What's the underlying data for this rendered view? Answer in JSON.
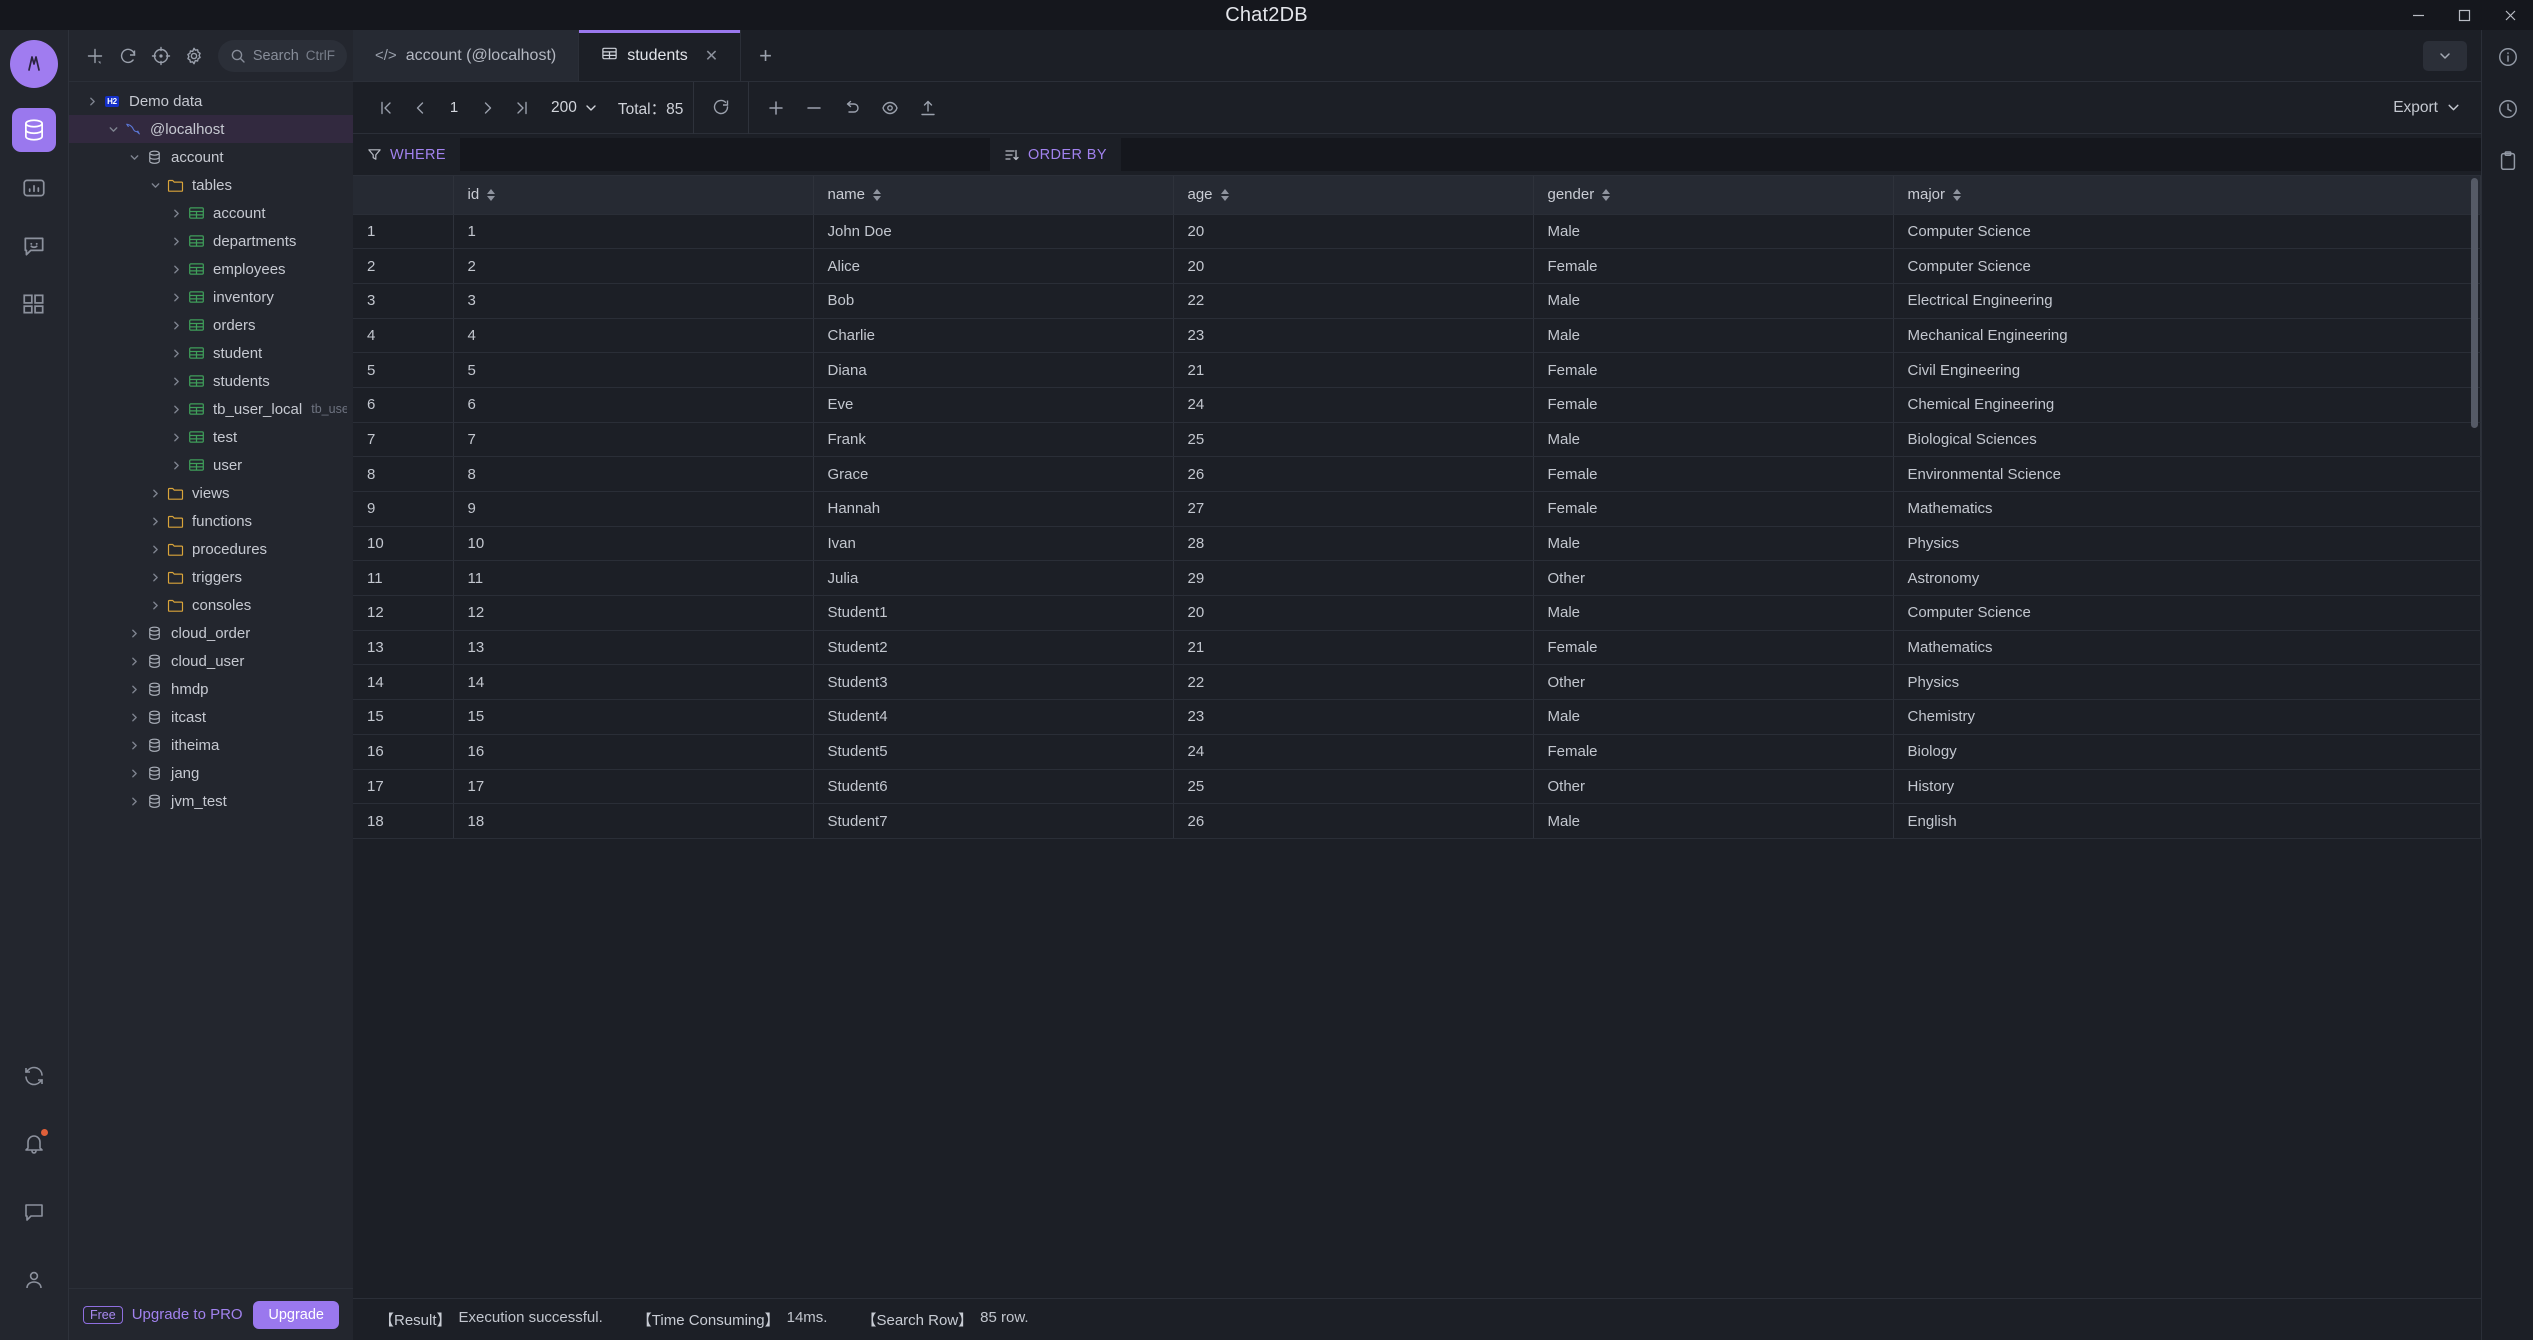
{
  "window": {
    "title": "Chat2DB",
    "controls": [
      "minimize",
      "maximize",
      "close"
    ]
  },
  "rail": {
    "logo": "chat2db-logo",
    "items": [
      {
        "name": "database",
        "icon": "database-icon",
        "active": true
      },
      {
        "name": "dashboard",
        "icon": "chart-bar-icon",
        "active": false
      },
      {
        "name": "chat",
        "icon": "chat-smile-icon",
        "active": false
      },
      {
        "name": "extensions",
        "icon": "grid-blocks-icon",
        "active": false
      }
    ],
    "bottom": [
      {
        "name": "sync",
        "icon": "sync-icon"
      },
      {
        "name": "notifications",
        "icon": "bell-icon"
      },
      {
        "name": "feedback",
        "icon": "message-icon"
      },
      {
        "name": "account",
        "icon": "user-icon"
      }
    ]
  },
  "sidebar": {
    "toolbar": {
      "add": "add-icon",
      "refresh": "refresh-icon",
      "locate": "target-icon",
      "settings": "gear-icon"
    },
    "search": {
      "placeholder": "Search",
      "shortcut": "CtrlF"
    },
    "tree": [
      {
        "label": "Demo data",
        "icon": "h2-badge",
        "indent": 0,
        "chevron": "right",
        "selected": false
      },
      {
        "label": "@localhost",
        "icon": "mysql-dolphin-icon",
        "indent": 1,
        "chevron": "down",
        "selected": true
      },
      {
        "label": "account",
        "icon": "database-icon",
        "indent": 2,
        "chevron": "down",
        "selected": false
      },
      {
        "label": "tables",
        "icon": "folder-icon",
        "indent": 3,
        "chevron": "down",
        "selected": false
      },
      {
        "label": "account",
        "icon": "table-icon",
        "indent": 4,
        "chevron": "right",
        "selected": false
      },
      {
        "label": "departments",
        "icon": "table-icon",
        "indent": 4,
        "chevron": "right",
        "selected": false
      },
      {
        "label": "employees",
        "icon": "table-icon",
        "indent": 4,
        "chevron": "right",
        "selected": false
      },
      {
        "label": "inventory",
        "icon": "table-icon",
        "indent": 4,
        "chevron": "right",
        "selected": false
      },
      {
        "label": "orders",
        "icon": "table-icon",
        "indent": 4,
        "chevron": "right",
        "selected": false
      },
      {
        "label": "student",
        "icon": "table-icon",
        "indent": 4,
        "chevron": "right",
        "selected": false
      },
      {
        "label": "students",
        "icon": "table-icon",
        "indent": 4,
        "chevron": "right",
        "selected": false
      },
      {
        "label": "tb_user_local",
        "sublabel": "tb_user_loca",
        "icon": "table-icon",
        "indent": 4,
        "chevron": "right",
        "selected": false
      },
      {
        "label": "test",
        "icon": "table-icon",
        "indent": 4,
        "chevron": "right",
        "selected": false
      },
      {
        "label": "user",
        "icon": "table-icon",
        "indent": 4,
        "chevron": "right",
        "selected": false
      },
      {
        "label": "views",
        "icon": "folder-icon",
        "indent": 3,
        "chevron": "right",
        "selected": false
      },
      {
        "label": "functions",
        "icon": "folder-icon",
        "indent": 3,
        "chevron": "right",
        "selected": false
      },
      {
        "label": "procedures",
        "icon": "folder-icon",
        "indent": 3,
        "chevron": "right",
        "selected": false
      },
      {
        "label": "triggers",
        "icon": "folder-icon",
        "indent": 3,
        "chevron": "right",
        "selected": false
      },
      {
        "label": "consoles",
        "icon": "folder-icon",
        "indent": 3,
        "chevron": "right",
        "selected": false
      },
      {
        "label": "cloud_order",
        "icon": "database-icon",
        "indent": 2,
        "chevron": "right",
        "selected": false
      },
      {
        "label": "cloud_user",
        "icon": "database-icon",
        "indent": 2,
        "chevron": "right",
        "selected": false
      },
      {
        "label": "hmdp",
        "icon": "database-icon",
        "indent": 2,
        "chevron": "right",
        "selected": false
      },
      {
        "label": "itcast",
        "icon": "database-icon",
        "indent": 2,
        "chevron": "right",
        "selected": false
      },
      {
        "label": "itheima",
        "icon": "database-icon",
        "indent": 2,
        "chevron": "right",
        "selected": false
      },
      {
        "label": "jang",
        "icon": "database-icon",
        "indent": 2,
        "chevron": "right",
        "selected": false
      },
      {
        "label": "jvm_test",
        "icon": "database-icon",
        "indent": 2,
        "chevron": "right",
        "selected": false
      }
    ],
    "upgrade": {
      "badge": "Free",
      "text": "Upgrade to PRO",
      "button": "Upgrade"
    }
  },
  "tabs": [
    {
      "label": "account (@localhost)",
      "icon": "code-icon",
      "active": false,
      "closable": false
    },
    {
      "label": "students",
      "icon": "table-icon",
      "active": true,
      "closable": true
    }
  ],
  "toolbar": {
    "first_page": "first-page-icon",
    "prev_page": "prev-page-icon",
    "page": "1",
    "next_page": "next-page-icon",
    "last_page": "last-page-icon",
    "page_size": "200",
    "total_label": "Total：",
    "total_value": "85",
    "actions": [
      {
        "name": "refresh",
        "icon": "refresh-icon"
      },
      {
        "name": "add-row",
        "icon": "plus-icon"
      },
      {
        "name": "delete-row",
        "icon": "minus-icon"
      },
      {
        "name": "revert",
        "icon": "undo-icon"
      },
      {
        "name": "preview",
        "icon": "eye-icon"
      },
      {
        "name": "commit",
        "icon": "upload-icon"
      }
    ],
    "export": "Export"
  },
  "filter": {
    "where_label": "WHERE",
    "where_value": "",
    "order_by_label": "ORDER BY",
    "order_by_value": ""
  },
  "table": {
    "columns": [
      "id",
      "name",
      "age",
      "gender",
      "major"
    ],
    "rows": [
      {
        "n": "1",
        "id": "1",
        "name": "John Doe",
        "age": "20",
        "gender": "Male",
        "major": "Computer Science"
      },
      {
        "n": "2",
        "id": "2",
        "name": "Alice",
        "age": "20",
        "gender": "Female",
        "major": "Computer Science"
      },
      {
        "n": "3",
        "id": "3",
        "name": "Bob",
        "age": "22",
        "gender": "Male",
        "major": "Electrical Engineering"
      },
      {
        "n": "4",
        "id": "4",
        "name": "Charlie",
        "age": "23",
        "gender": "Male",
        "major": "Mechanical Engineering"
      },
      {
        "n": "5",
        "id": "5",
        "name": "Diana",
        "age": "21",
        "gender": "Female",
        "major": "Civil Engineering"
      },
      {
        "n": "6",
        "id": "6",
        "name": "Eve",
        "age": "24",
        "gender": "Female",
        "major": "Chemical Engineering"
      },
      {
        "n": "7",
        "id": "7",
        "name": "Frank",
        "age": "25",
        "gender": "Male",
        "major": "Biological Sciences"
      },
      {
        "n": "8",
        "id": "8",
        "name": "Grace",
        "age": "26",
        "gender": "Female",
        "major": "Environmental Science"
      },
      {
        "n": "9",
        "id": "9",
        "name": "Hannah",
        "age": "27",
        "gender": "Female",
        "major": "Mathematics"
      },
      {
        "n": "10",
        "id": "10",
        "name": "Ivan",
        "age": "28",
        "gender": "Male",
        "major": "Physics"
      },
      {
        "n": "11",
        "id": "11",
        "name": "Julia",
        "age": "29",
        "gender": "Other",
        "major": "Astronomy"
      },
      {
        "n": "12",
        "id": "12",
        "name": "Student1",
        "age": "20",
        "gender": "Male",
        "major": "Computer Science"
      },
      {
        "n": "13",
        "id": "13",
        "name": "Student2",
        "age": "21",
        "gender": "Female",
        "major": "Mathematics"
      },
      {
        "n": "14",
        "id": "14",
        "name": "Student3",
        "age": "22",
        "gender": "Other",
        "major": "Physics"
      },
      {
        "n": "15",
        "id": "15",
        "name": "Student4",
        "age": "23",
        "gender": "Male",
        "major": "Chemistry"
      },
      {
        "n": "16",
        "id": "16",
        "name": "Student5",
        "age": "24",
        "gender": "Female",
        "major": "Biology"
      },
      {
        "n": "17",
        "id": "17",
        "name": "Student6",
        "age": "25",
        "gender": "Other",
        "major": "History"
      },
      {
        "n": "18",
        "id": "18",
        "name": "Student7",
        "age": "26",
        "gender": "Male",
        "major": "English"
      }
    ]
  },
  "status": [
    {
      "key": "【Result】",
      "value": "Execution successful."
    },
    {
      "key": "【Time Consuming】",
      "value": "14ms."
    },
    {
      "key": "【Search Row】",
      "value": "85 row."
    }
  ],
  "rightrail": [
    {
      "name": "info",
      "icon": "info-icon"
    },
    {
      "name": "history",
      "icon": "clock-icon"
    },
    {
      "name": "clipboard",
      "icon": "clipboard-icon"
    }
  ],
  "colors": {
    "accent": "#9a78ee",
    "table_icon": "#3f9e5a",
    "folder_icon": "#d9a43a",
    "bg": "#1c1f26",
    "panel": "#23262e"
  }
}
